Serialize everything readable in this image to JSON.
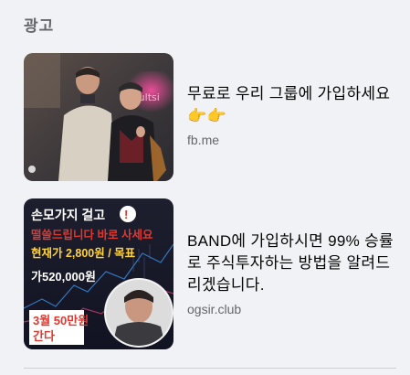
{
  "section": {
    "title": "광고"
  },
  "ads": [
    {
      "headline": "무료로 우리 그룹에 가입하세요👉👉",
      "domain": "fb.me"
    },
    {
      "headline": "BAND에 가입하시면 99% 승률로 주식투자하는 방법을 알려드리겠습니다.",
      "domain": "ogsir.club",
      "image_text": {
        "line1": "손모가지 걸고",
        "line2": "떨쓸드립니다 바로 사세요",
        "line3": "현재가 2,800원 / 목표",
        "line4": "가520,000원",
        "line5a": "3월 50만원",
        "line5b": "간다",
        "badge": "!"
      }
    }
  ],
  "colors": {
    "background": "#f0f2f5",
    "muted_text": "#65676b",
    "ad2_title": "#ffffff",
    "ad2_red": "#e0372f",
    "ad2_yellow": "#ffd23f"
  }
}
